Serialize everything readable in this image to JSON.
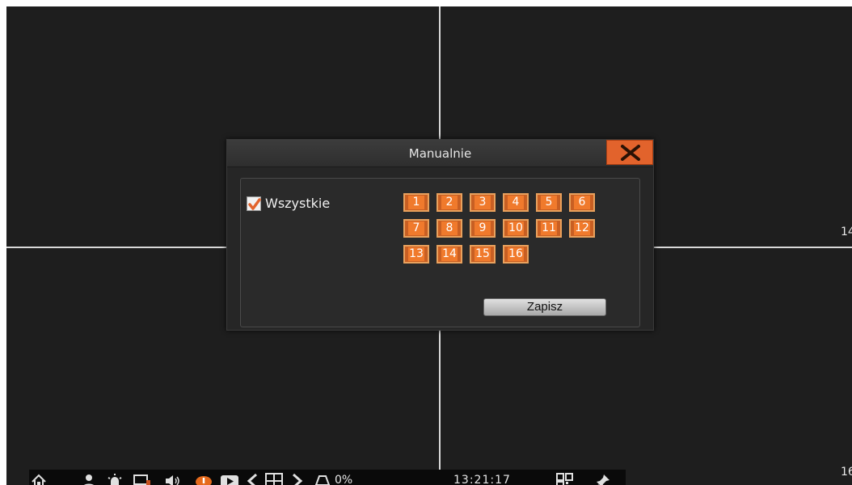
{
  "dialog": {
    "title": "Manualnie",
    "all_label": "Wszystkie",
    "all_checked": true,
    "channels": [
      "1",
      "2",
      "3",
      "4",
      "5",
      "6",
      "7",
      "8",
      "9",
      "10",
      "11",
      "12",
      "13",
      "14",
      "15",
      "16"
    ],
    "save_label": "Zapisz"
  },
  "screen": {
    "channel_label_right_top": "14",
    "channel_label_right_bottom": "16"
  },
  "taskbar": {
    "disk_usage": "0%",
    "time": "13:21:17",
    "icons": [
      "home-icon",
      "user-icon",
      "alarm-icon",
      "monitor-icon",
      "volume-icon",
      "record-icon",
      "playback-icon",
      "prev-icon",
      "grid-layout-icon",
      "next-icon",
      "disk-icon",
      "qr-code-icon",
      "pin-icon"
    ]
  },
  "colors": {
    "accent": "#e2632c",
    "channel_fill": "#f07a2c",
    "background": "#1e1e1e"
  }
}
